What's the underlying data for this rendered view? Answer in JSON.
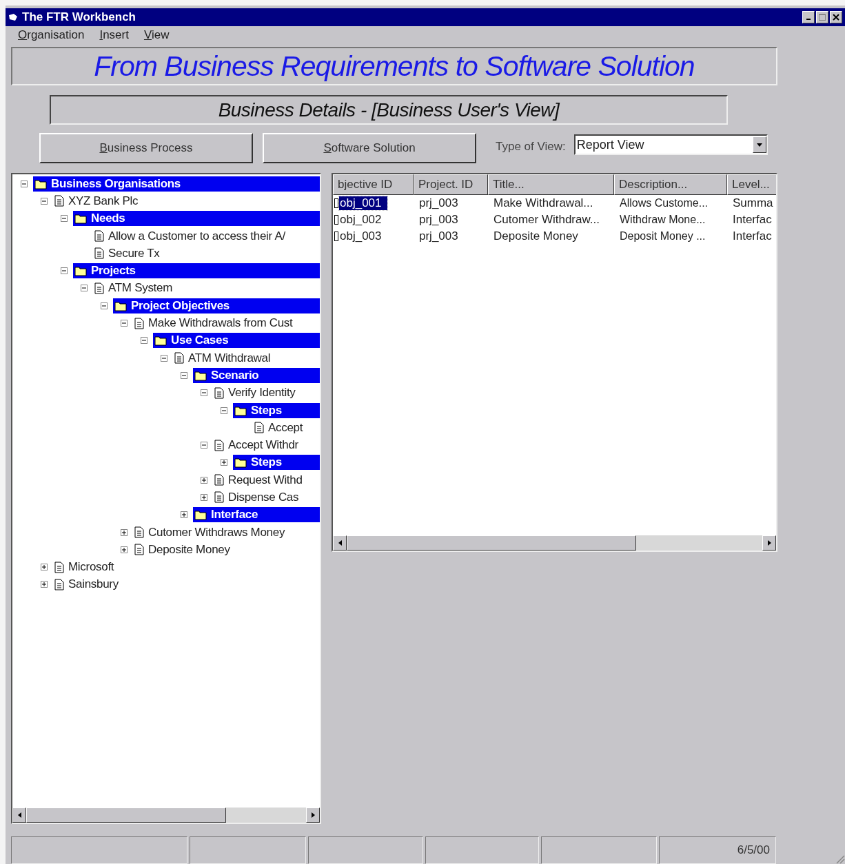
{
  "window": {
    "title": "The FTR Workbench"
  },
  "menu": [
    {
      "label": "Organisation"
    },
    {
      "label": "Insert"
    },
    {
      "label": "View"
    }
  ],
  "banner": "From Business Requirements to Software Solution",
  "subtitle": "Business Details - [Business User's View]",
  "buttons": [
    {
      "label": "Business Process"
    },
    {
      "label": "Software Solution"
    }
  ],
  "view_type": {
    "label": "Type of View:",
    "value": "Report View"
  },
  "tree": [
    {
      "label": "Business Organisations",
      "kind": "folder",
      "expandable": true,
      "expanded": true,
      "children": [
        {
          "label": "XYZ Bank Plc",
          "kind": "document",
          "expandable": true,
          "expanded": true,
          "children": [
            {
              "label": "Needs",
              "kind": "folder",
              "expandable": true,
              "expanded": true,
              "children": [
                {
                  "label": "Allow a Customer to access their A/",
                  "kind": "document",
                  "expandable": false
                },
                {
                  "label": "Secure Tx",
                  "kind": "document",
                  "expandable": false
                }
              ]
            },
            {
              "label": "Projects",
              "kind": "folder",
              "expandable": true,
              "expanded": true,
              "children": [
                {
                  "label": "ATM System",
                  "kind": "document",
                  "expandable": true,
                  "expanded": true,
                  "children": [
                    {
                      "label": "Project Objectives",
                      "kind": "folder",
                      "expandable": true,
                      "expanded": true,
                      "children": [
                        {
                          "label": "Make Withdrawals from Cust",
                          "kind": "document",
                          "expandable": true,
                          "expanded": true,
                          "children": [
                            {
                              "label": "Use Cases",
                              "kind": "folder",
                              "expandable": true,
                              "expanded": true,
                              "children": [
                                {
                                  "label": "ATM Withdrawal",
                                  "kind": "document",
                                  "expandable": true,
                                  "expanded": true,
                                  "children": [
                                    {
                                      "label": "Scenario",
                                      "kind": "folder",
                                      "expandable": true,
                                      "expanded": true,
                                      "children": [
                                        {
                                          "label": "Verify Identity",
                                          "kind": "document",
                                          "expandable": true,
                                          "expanded": true,
                                          "children": [
                                            {
                                              "label": "Steps",
                                              "kind": "folder",
                                              "expandable": true,
                                              "expanded": true,
                                              "children": [
                                                {
                                                  "label": "Accept",
                                                  "kind": "document",
                                                  "expandable": false
                                                }
                                              ]
                                            }
                                          ]
                                        },
                                        {
                                          "label": "Accept Withdr",
                                          "kind": "document",
                                          "expandable": true,
                                          "expanded": true,
                                          "children": [
                                            {
                                              "label": "Steps",
                                              "kind": "folder",
                                              "expandable": true,
                                              "expanded": false
                                            }
                                          ]
                                        },
                                        {
                                          "label": "Request Withd",
                                          "kind": "document",
                                          "expandable": true,
                                          "expanded": false
                                        },
                                        {
                                          "label": "Dispense Cas",
                                          "kind": "document",
                                          "expandable": true,
                                          "expanded": false
                                        }
                                      ]
                                    },
                                    {
                                      "label": "Interface",
                                      "kind": "folder",
                                      "expandable": true,
                                      "expanded": false
                                    }
                                  ]
                                }
                              ]
                            }
                          ]
                        },
                        {
                          "label": "Cutomer Withdraws Money",
                          "kind": "document",
                          "expandable": true,
                          "expanded": false
                        },
                        {
                          "label": "Deposite Money",
                          "kind": "document",
                          "expandable": true,
                          "expanded": false
                        }
                      ]
                    }
                  ]
                }
              ]
            }
          ]
        },
        {
          "label": "Microsoft",
          "kind": "document",
          "expandable": true,
          "expanded": false
        },
        {
          "label": "Sainsbury",
          "kind": "document",
          "expandable": true,
          "expanded": false
        }
      ]
    }
  ],
  "table": {
    "columns": [
      "bjective ID",
      "Project. ID",
      "Title...",
      "Description...",
      "Level..."
    ],
    "rows": [
      {
        "selected": true,
        "cells": [
          "obj_001",
          "prj_003",
          "Make Withdrawal...",
          "Allows Custome...",
          "Summa"
        ]
      },
      {
        "selected": false,
        "cells": [
          "obj_002",
          "prj_003",
          "Cutomer Withdraw...",
          "Withdraw Mone...",
          "Interfac"
        ]
      },
      {
        "selected": false,
        "cells": [
          "obj_003",
          "prj_003",
          "Deposite Money",
          "Deposit Money ...",
          "Interfac"
        ]
      }
    ]
  },
  "status_bar": {
    "date": "6/5/00"
  }
}
